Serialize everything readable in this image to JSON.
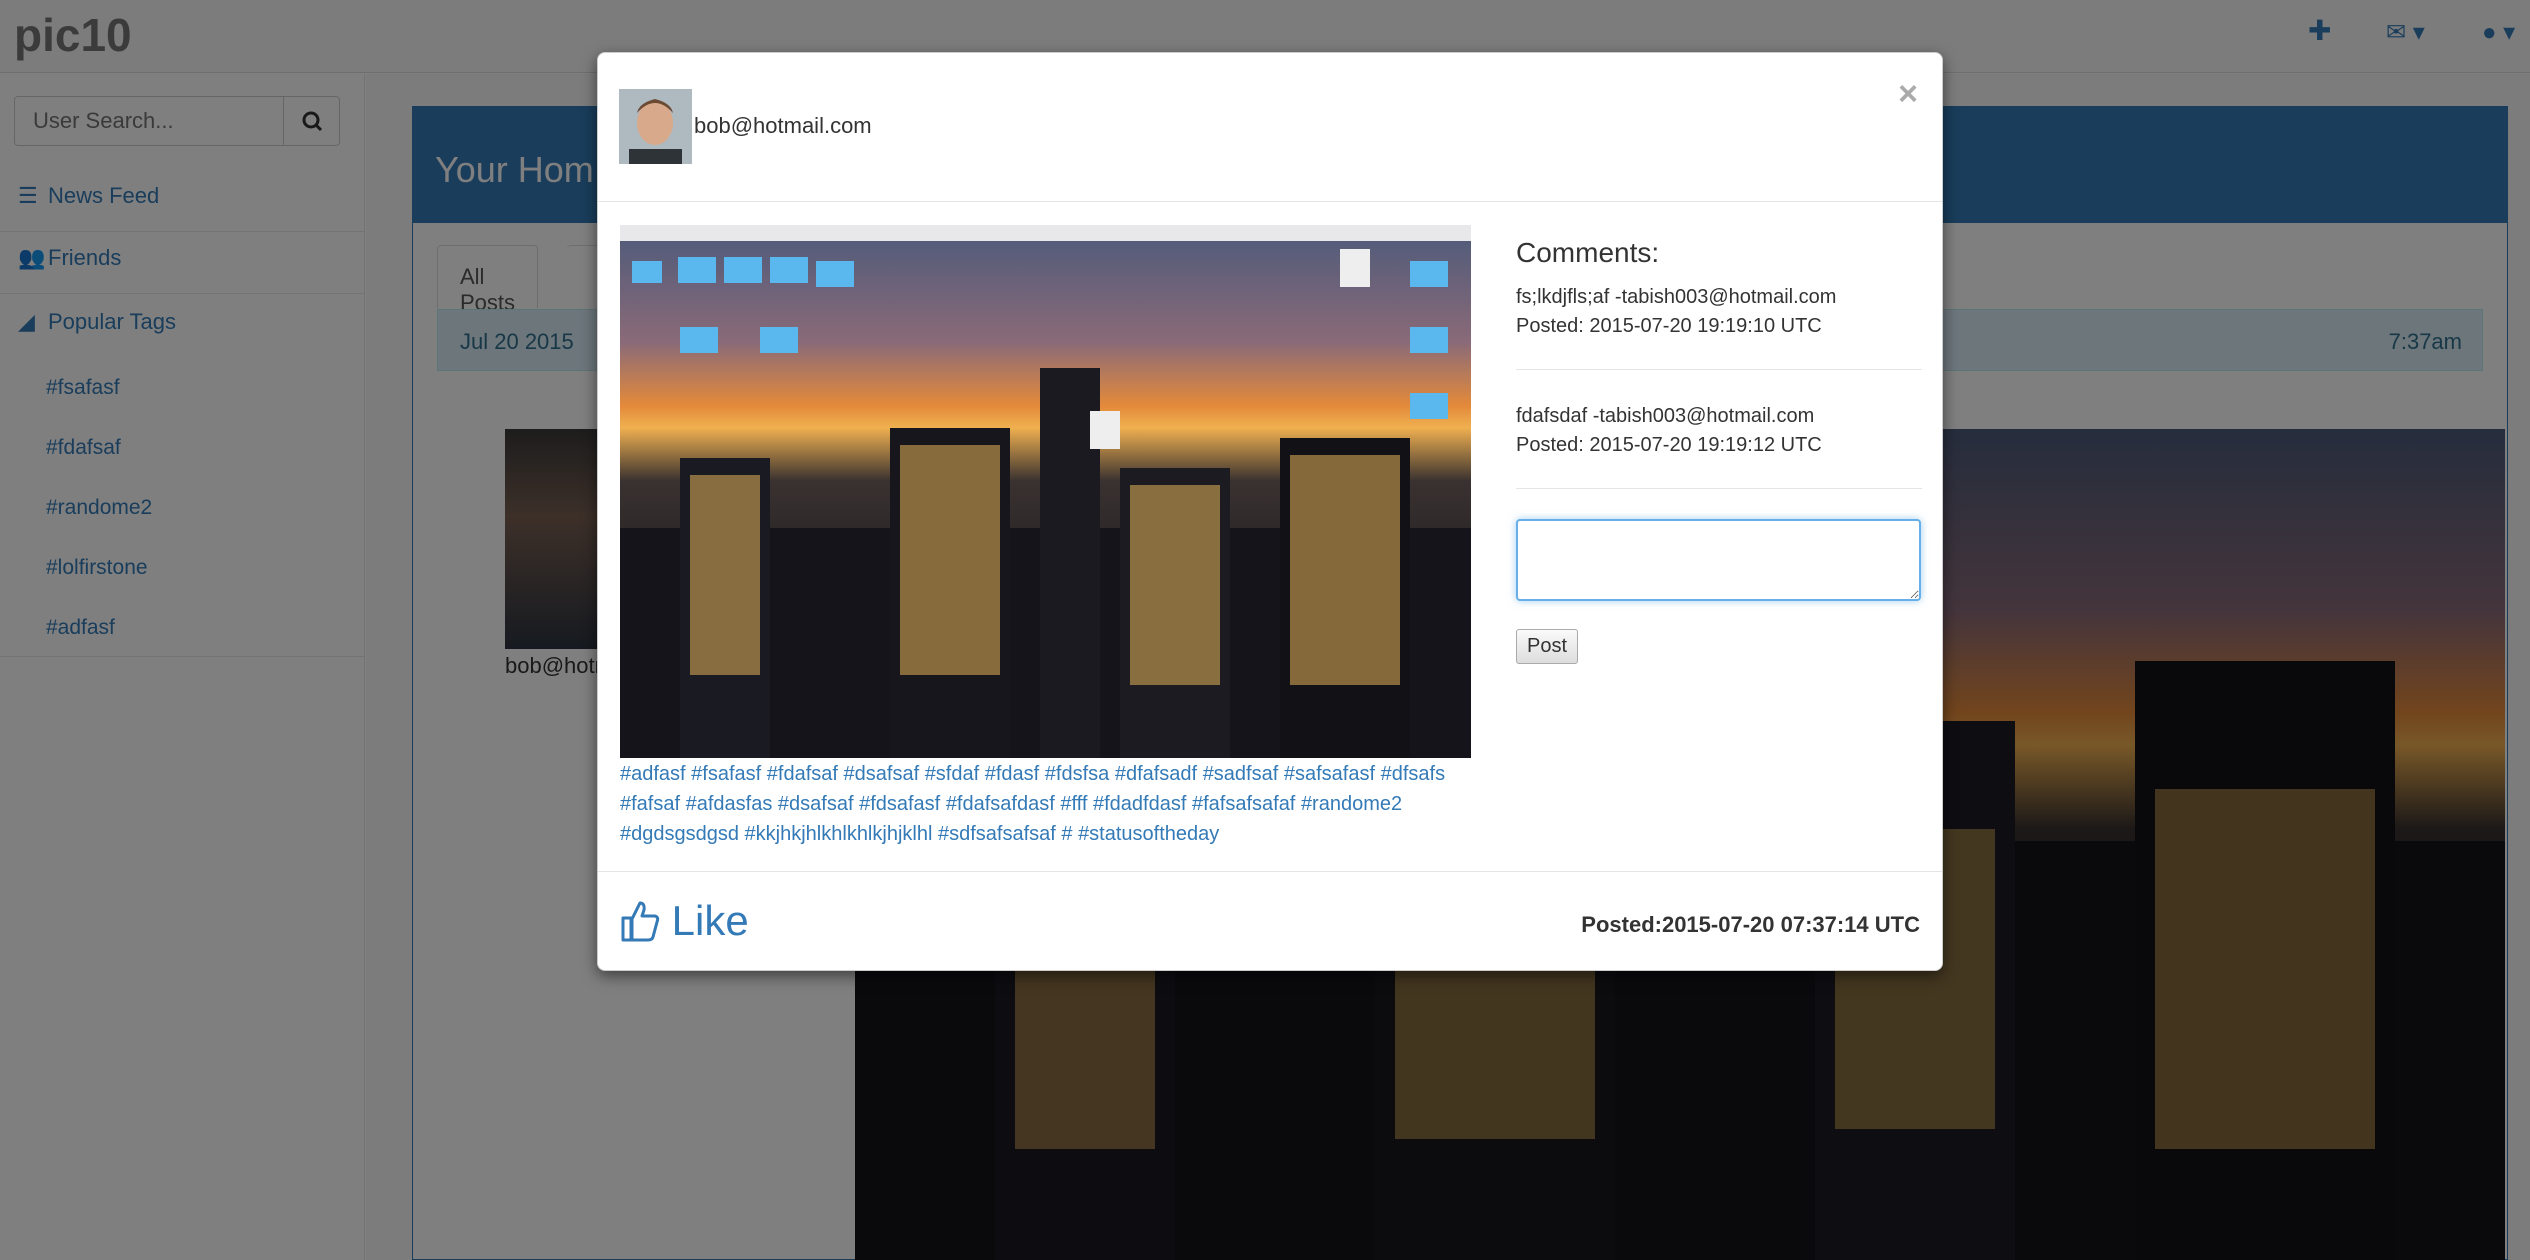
{
  "app": {
    "brand": "pic10"
  },
  "topbar": {
    "icons": [
      "plus-icon",
      "envelope-icon",
      "user-icon"
    ],
    "accent": "#337ab7"
  },
  "sidebar": {
    "search": {
      "placeholder": "User Search..."
    },
    "items": [
      {
        "label": "News Feed",
        "icon": "list-icon"
      },
      {
        "label": "Friends",
        "icon": "users-icon"
      },
      {
        "label": "Popular Tags",
        "icon": "rss-icon"
      }
    ],
    "tags": [
      "#fsafasf",
      "#fdafsaf",
      "#randome2",
      "#lolfirstone",
      "#adfasf"
    ]
  },
  "panel": {
    "title": "Your Hom",
    "tabs": [
      {
        "label": "All Posts"
      }
    ],
    "feed": {
      "date": "Jul 20 2015",
      "time": "7:37am",
      "user": "bob@hotmail.c"
    }
  },
  "modal": {
    "user": "bob@hotmail.com",
    "close": "×",
    "tags": [
      "#adfasf",
      "#fsafasf",
      "#fdafsaf",
      "#dsafsaf",
      "#sfdaf",
      "#fdasf",
      "#fdsfsa",
      "#dfafsadf",
      "#sadfsaf",
      "#safsafasf",
      "#dfsafs",
      "#fafsaf",
      "#afdasfas",
      "#dsafsaf",
      "#fdsafasf",
      "#fdafsafdasf",
      "#fff",
      "#fdadfdasf",
      "#fafsafsafaf",
      "#randome2",
      "#dgdsgsdgsd",
      "#kkjhkjhlkhlkhlkjhjklhl",
      "#sdfsafsafsaf",
      "#",
      "#statusoftheday"
    ],
    "comments_title": "Comments:",
    "comments": [
      {
        "text": "fs;lkdjfls;af -tabish003@hotmail.com",
        "posted": "Posted: 2015-07-20 19:19:10 UTC"
      },
      {
        "text": "fdafsdaf -tabish003@hotmail.com",
        "posted": "Posted: 2015-07-20 19:19:12 UTC"
      }
    ],
    "comment_input": {
      "value": ""
    },
    "post_button": "Post",
    "like_label": "Like",
    "posted_at": "Posted:2015-07-20 07:37:14 UTC"
  }
}
